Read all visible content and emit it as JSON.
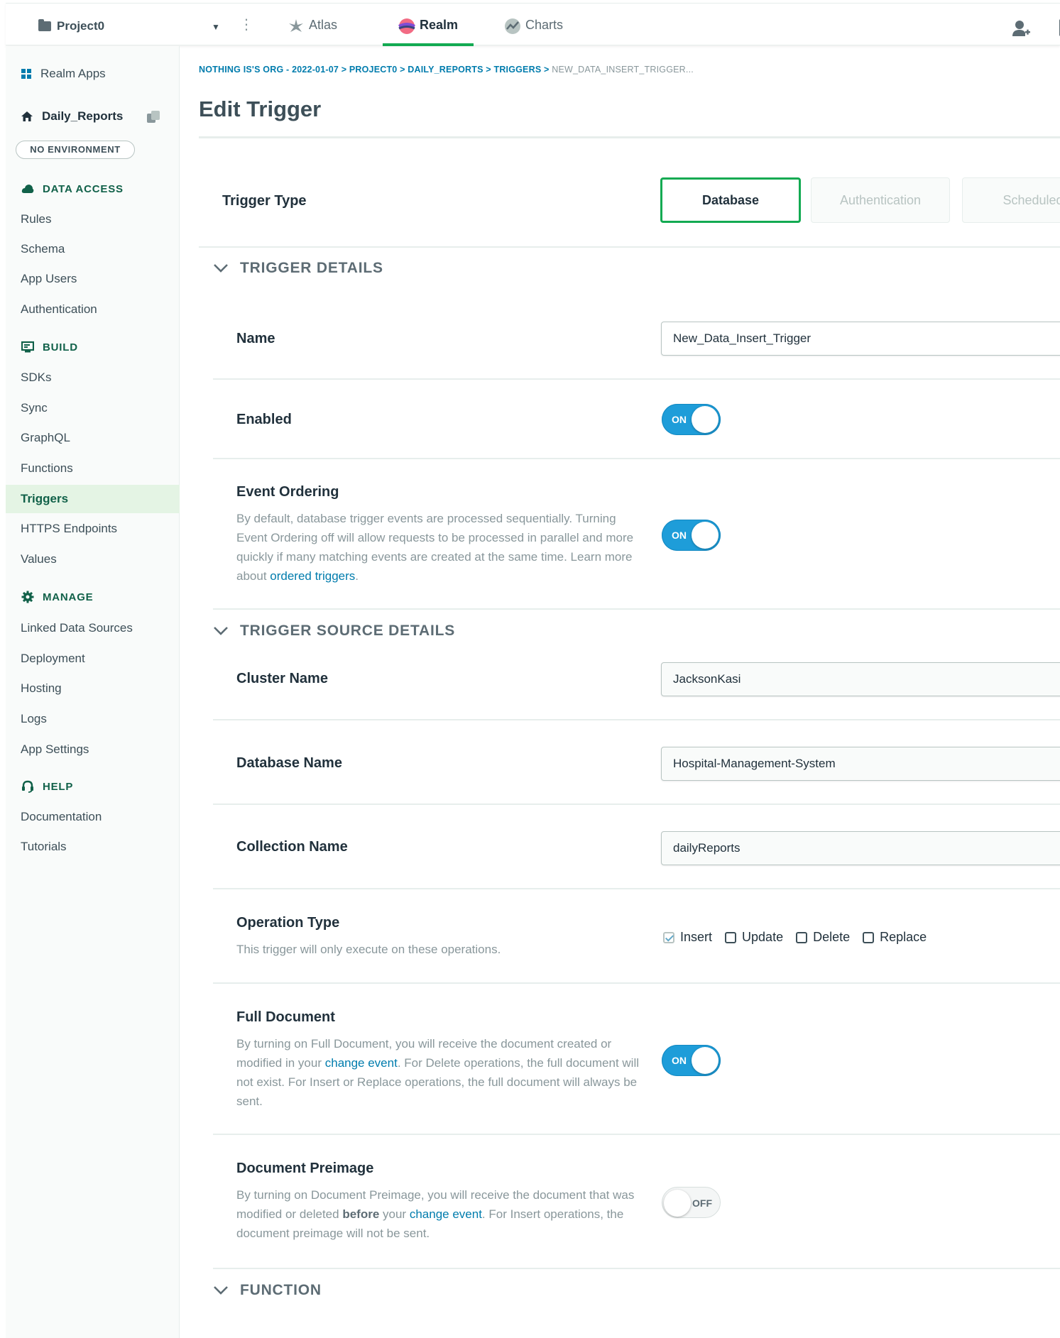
{
  "topbar": {
    "project": "Project0",
    "tabs": [
      {
        "label": "Atlas",
        "icon": "atlas-leaf-icon"
      },
      {
        "label": "Realm",
        "icon": "realm-logo-icon",
        "active": true
      },
      {
        "label": "Charts",
        "icon": "charts-icon"
      }
    ]
  },
  "sidebar": {
    "apps_label": "Realm Apps",
    "app_name": "Daily_Reports",
    "environment": "NO ENVIRONMENT",
    "sections": [
      {
        "heading": "DATA ACCESS",
        "items": [
          "Rules",
          "Schema",
          "App Users",
          "Authentication"
        ]
      },
      {
        "heading": "BUILD",
        "items": [
          "SDKs",
          "Sync",
          "GraphQL",
          "Functions",
          "Triggers",
          "HTTPS Endpoints",
          "Values"
        ]
      },
      {
        "heading": "MANAGE",
        "items": [
          "Linked Data Sources",
          "Deployment",
          "Hosting",
          "Logs",
          "App Settings"
        ]
      },
      {
        "heading": "HELP",
        "items": [
          "Documentation",
          "Tutorials"
        ]
      }
    ],
    "active_item": "Triggers"
  },
  "breadcrumb": {
    "path": "NOTHING IS'S ORG - 2022-01-07 > PROJECT0 > DAILY_REPORTS > TRIGGERS >",
    "current": "NEW_DATA_INSERT_TRIGGER..."
  },
  "page": {
    "title": "Edit Trigger",
    "trigger_type_label": "Trigger Type",
    "trigger_types": [
      "Database",
      "Authentication",
      "Scheduled"
    ],
    "selected_type": "Database"
  },
  "details": {
    "heading": "TRIGGER DETAILS",
    "name_label": "Name",
    "name_value": "New_Data_Insert_Trigger",
    "enabled_label": "Enabled",
    "enabled_state": "ON",
    "ordering_label": "Event Ordering",
    "ordering_desc": "By default, database trigger events are processed sequentially. Turning Event Ordering off will allow requests to be processed in parallel and more quickly if many matching events are created at the same time. Learn more about ",
    "ordering_link": "ordered triggers",
    "ordering_state": "ON"
  },
  "source": {
    "heading": "TRIGGER SOURCE DETAILS",
    "cluster_label": "Cluster Name",
    "cluster_value": "JacksonKasi",
    "database_label": "Database Name",
    "database_value": "Hospital-Management-System",
    "collection_label": "Collection Name",
    "collection_value": "dailyReports",
    "operation_label": "Operation Type",
    "operation_desc": "This trigger will only execute on these operations.",
    "operations": [
      {
        "label": "Insert",
        "checked": true
      },
      {
        "label": "Update",
        "checked": false
      },
      {
        "label": "Delete",
        "checked": false
      },
      {
        "label": "Replace",
        "checked": false
      }
    ],
    "full_doc_label": "Full Document",
    "full_doc_desc_1": "By turning on Full Document, you will receive the document created or modified in your ",
    "full_doc_link": "change event",
    "full_doc_desc_2": ". For Delete operations, the full document will not exist. For Insert or Replace operations, the full document will always be sent.",
    "full_doc_state": "ON",
    "preimage_label": "Document Preimage",
    "preimage_desc_1": "By turning on Document Preimage, you will receive the document that was modified or deleted ",
    "preimage_bold": "before",
    "preimage_desc_2": " your ",
    "preimage_link": "change event",
    "preimage_desc_3": ". For Insert operations, the document preimage will not be sent.",
    "preimage_state": "OFF"
  },
  "function": {
    "heading": "FUNCTION"
  }
}
